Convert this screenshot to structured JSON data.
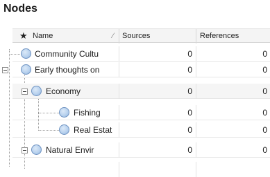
{
  "panel": {
    "title": "Nodes"
  },
  "columns": {
    "name": "Name",
    "sources": "Sources",
    "references": "References"
  },
  "rows": [
    {
      "name": "Community Cultu",
      "sources": "0",
      "references": "0"
    },
    {
      "name": "Early thoughts on",
      "sources": "0",
      "references": "0"
    },
    {
      "name": "Economy",
      "sources": "0",
      "references": "0"
    },
    {
      "name": "Fishing",
      "sources": "0",
      "references": "0"
    },
    {
      "name": "Real Estat",
      "sources": "0",
      "references": "0"
    },
    {
      "name": "Natural Envir",
      "sources": "0",
      "references": "0"
    }
  ]
}
